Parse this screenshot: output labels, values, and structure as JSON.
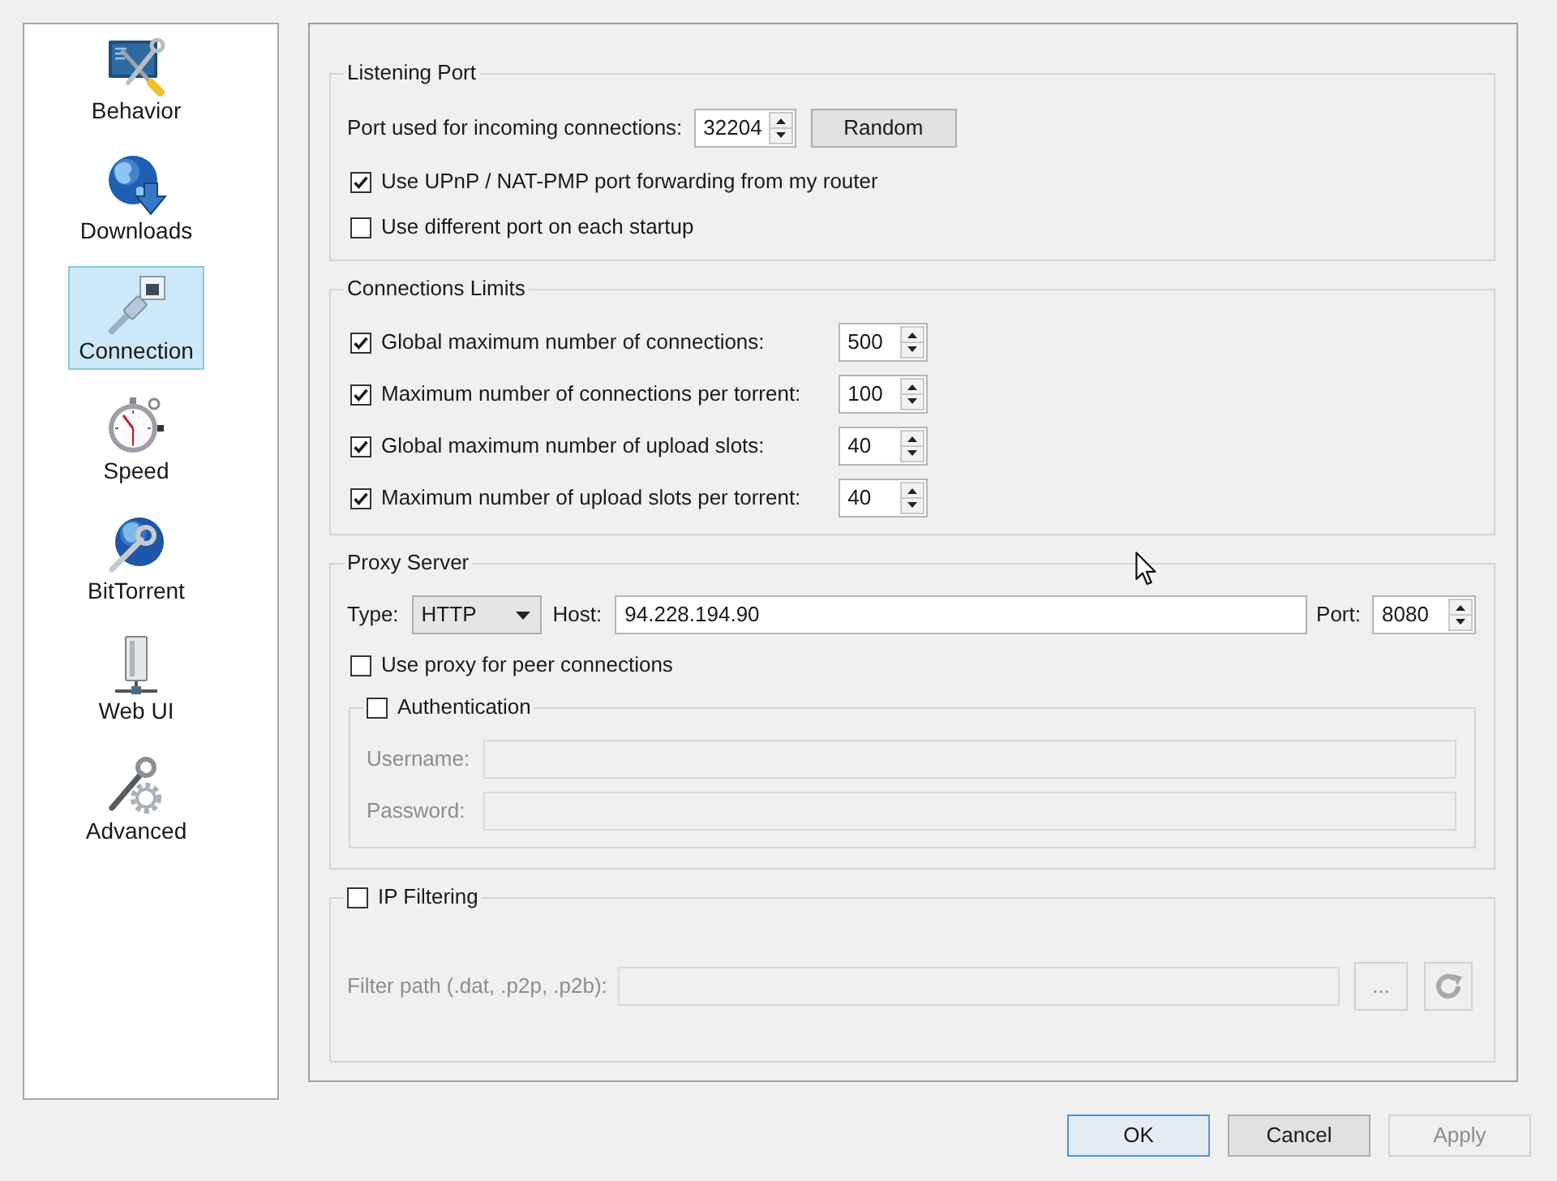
{
  "sidebar": {
    "items": [
      {
        "label": "Behavior",
        "selected": false
      },
      {
        "label": "Downloads",
        "selected": false
      },
      {
        "label": "Connection",
        "selected": true
      },
      {
        "label": "Speed",
        "selected": false
      },
      {
        "label": "BitTorrent",
        "selected": false
      },
      {
        "label": "Web UI",
        "selected": false
      },
      {
        "label": "Advanced",
        "selected": false
      }
    ]
  },
  "listening_port": {
    "title": "Listening Port",
    "port": {
      "label": "Port used for incoming connections:",
      "value": "32204"
    },
    "random_button": {
      "label": "Random"
    },
    "options": [
      {
        "label": "Use UPnP / NAT-PMP port forwarding from my router",
        "checked": true
      },
      {
        "label": "Use different port on each startup",
        "checked": false
      }
    ]
  },
  "connections_limits": {
    "title": "Connections Limits",
    "limits": [
      {
        "label": "Global maximum number of connections:",
        "checked": true,
        "value": "500"
      },
      {
        "label": "Maximum number of connections per torrent:",
        "checked": true,
        "value": "100"
      },
      {
        "label": "Global maximum number of upload slots:",
        "checked": true,
        "value": "40"
      },
      {
        "label": "Maximum number of upload slots per torrent:",
        "checked": true,
        "value": "40"
      }
    ]
  },
  "proxy_server": {
    "title": "Proxy Server",
    "type": {
      "label": "Type:",
      "value": "HTTP"
    },
    "host": {
      "label": "Host:",
      "value": "94.228.194.90"
    },
    "port": {
      "label": "Port:",
      "value": "8080"
    },
    "peer_connections": {
      "label": "Use proxy for peer connections",
      "checked": false
    },
    "authentication": {
      "label": "Authentication",
      "checked": false,
      "fields": [
        {
          "label": "Username:",
          "disabled": true
        },
        {
          "label": "Password:",
          "disabled": true
        }
      ]
    }
  },
  "ip_filtering": {
    "label": "IP Filtering",
    "checked": false,
    "filter_path": {
      "label": "Filter path (.dat, .p2p, .p2b):",
      "disabled": true
    },
    "browse_button": {
      "label": "...",
      "disabled": true
    },
    "reload_button": {
      "disabled": true
    }
  },
  "buttons": [
    {
      "label": "OK",
      "default": true,
      "disabled": false
    },
    {
      "label": "Cancel",
      "default": false,
      "disabled": false
    },
    {
      "label": "Apply",
      "default": false,
      "disabled": true
    }
  ]
}
